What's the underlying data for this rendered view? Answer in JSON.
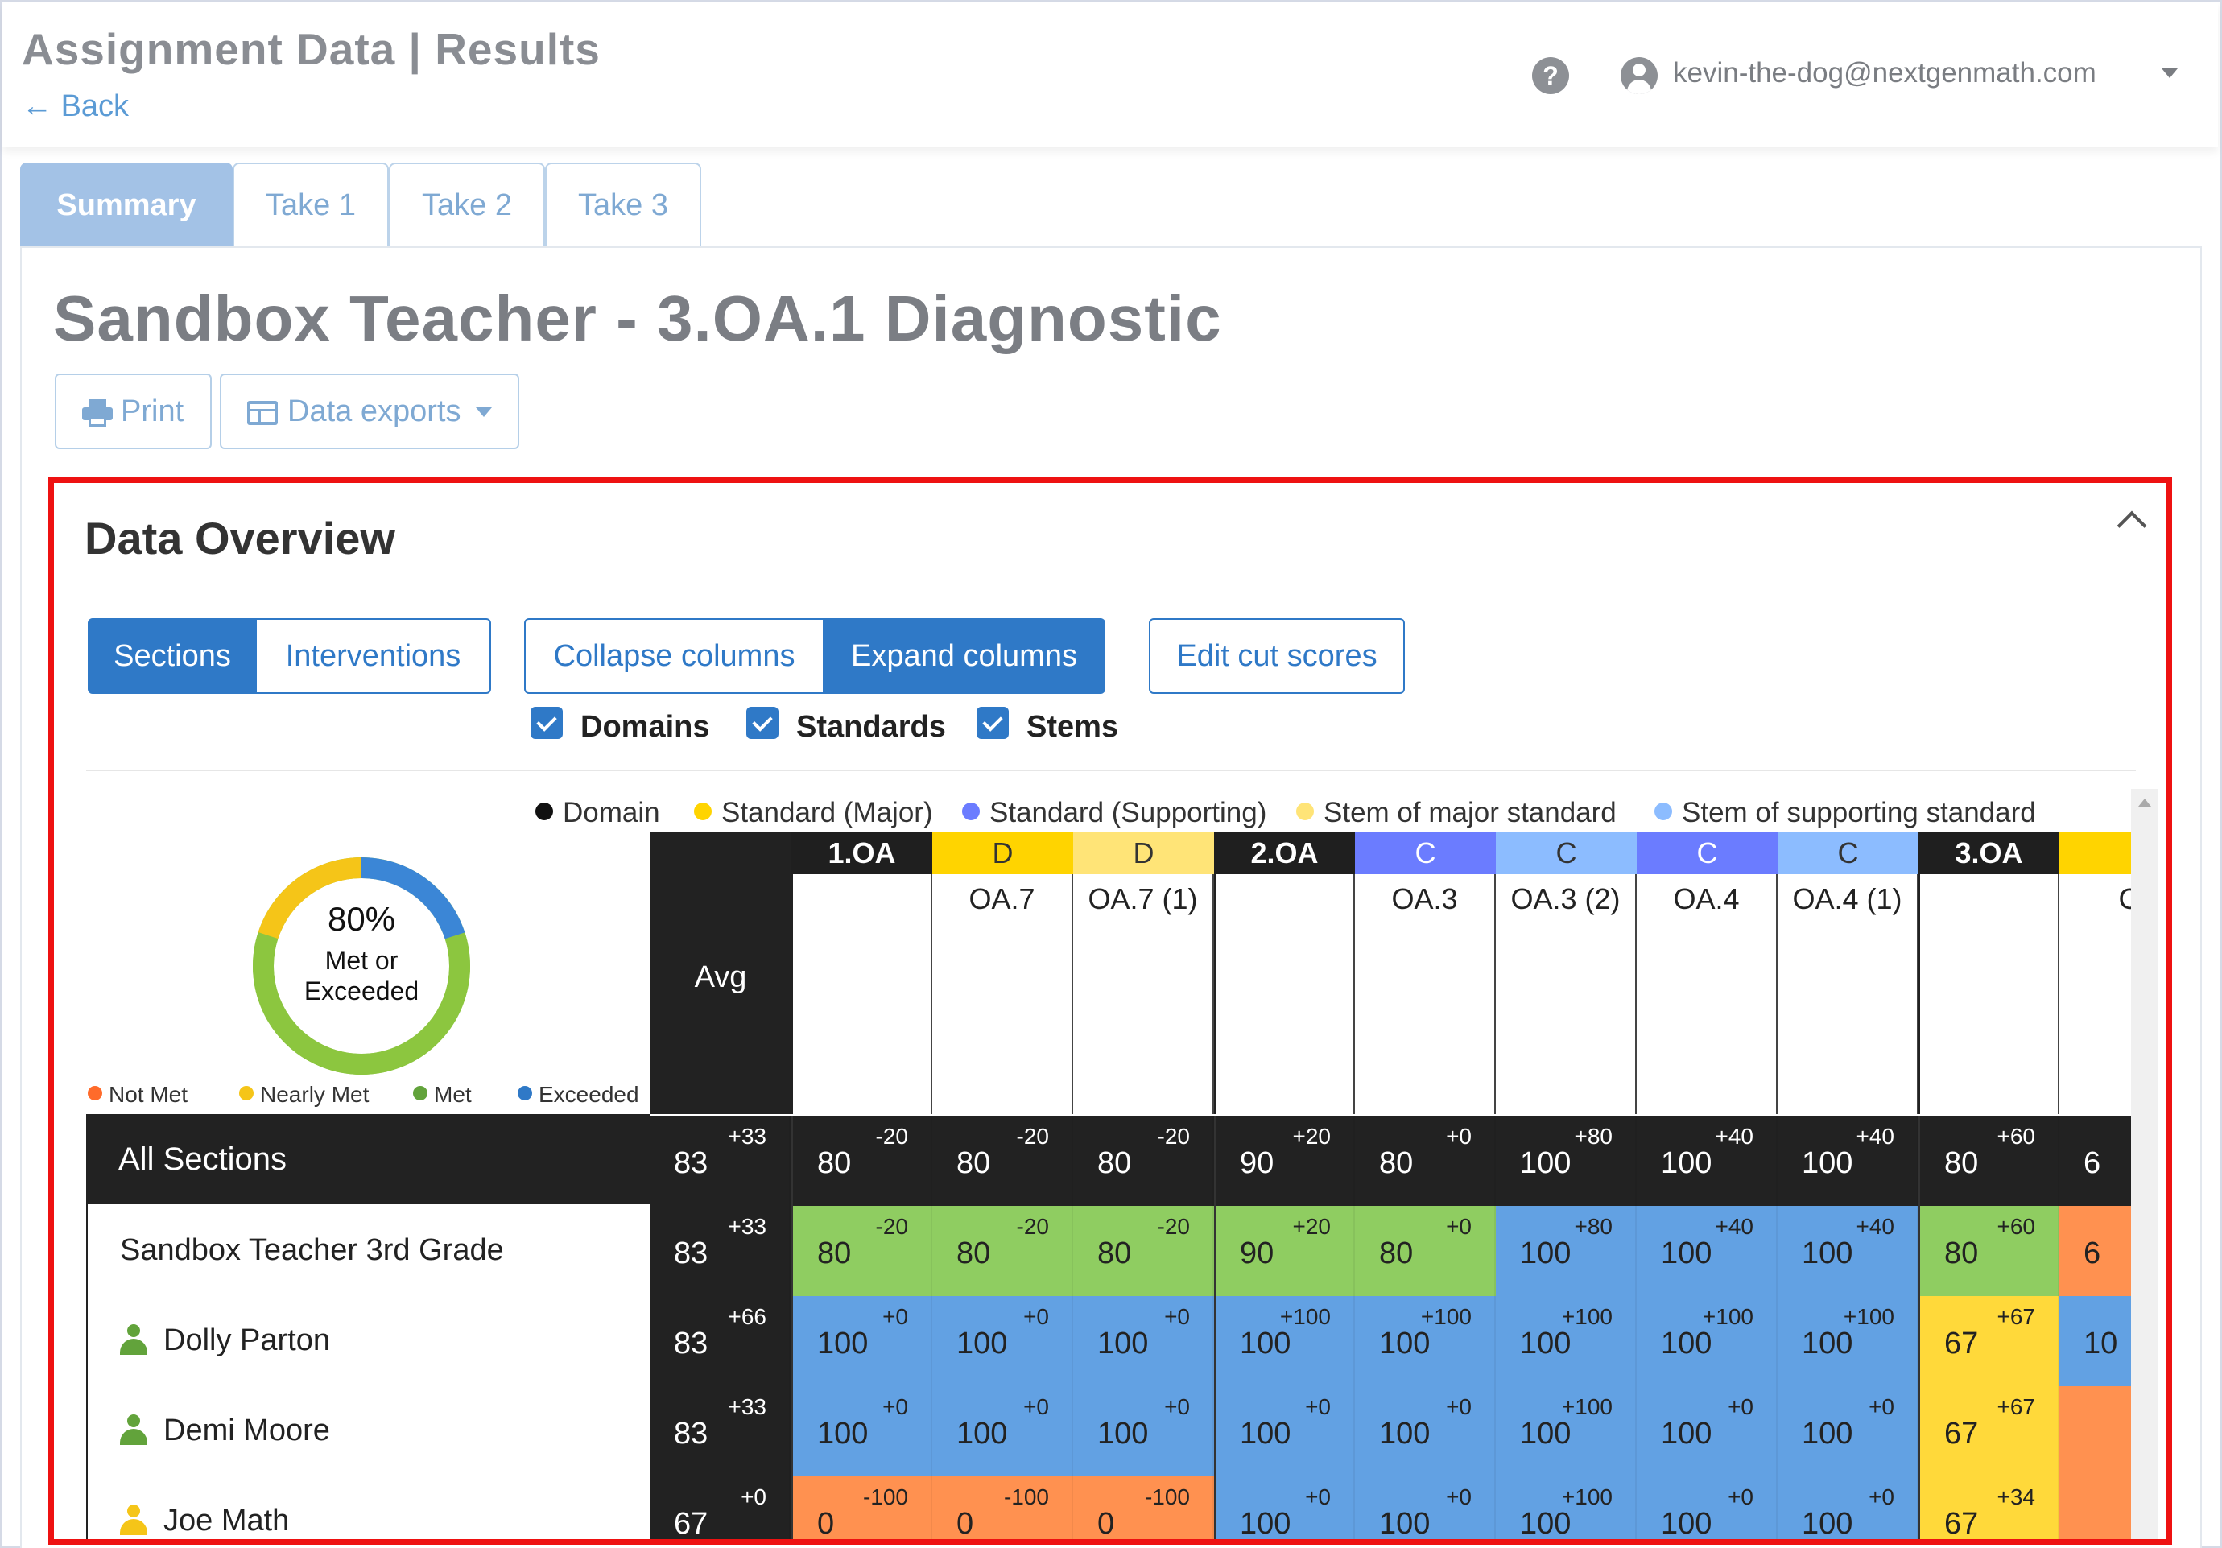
{
  "header": {
    "app_title": "Assignment Data | Results",
    "back_label": "Back",
    "help_glyph": "?",
    "user_email": "kevin-the-dog@nextgenmath.com"
  },
  "tabs": [
    {
      "label": "Summary",
      "active": true
    },
    {
      "label": "Take 1",
      "active": false
    },
    {
      "label": "Take 2",
      "active": false
    },
    {
      "label": "Take 3",
      "active": false
    }
  ],
  "page": {
    "title": "Sandbox Teacher - 3.OA.1 Diagnostic",
    "print_label": "Print",
    "exports_label": "Data exports"
  },
  "overview": {
    "title": "Data Overview",
    "view_toggle": [
      {
        "label": "Sections",
        "active": true
      },
      {
        "label": "Interventions",
        "active": false
      }
    ],
    "column_toggle": [
      {
        "label": "Collapse columns",
        "active": false
      },
      {
        "label": "Expand columns",
        "active": true
      }
    ],
    "edit_cut_scores": "Edit cut scores",
    "checkboxes": [
      {
        "label": "Domains",
        "checked": true
      },
      {
        "label": "Standards",
        "checked": true
      },
      {
        "label": "Stems",
        "checked": true
      }
    ],
    "legend_types": [
      {
        "label": "Domain",
        "color": "#111111"
      },
      {
        "label": "Standard (Major)",
        "color": "#ffd400"
      },
      {
        "label": "Standard (Supporting)",
        "color": "#6b7cff"
      },
      {
        "label": "Stem of major standard",
        "color": "#ffe477"
      },
      {
        "label": "Stem of supporting standard",
        "color": "#8cbcff"
      }
    ],
    "donut": {
      "percent": "80%",
      "caption_line1": "Met or",
      "caption_line2": "Exceeded",
      "segments": [
        {
          "name": "Exceeded",
          "fraction": 0.2,
          "color": "#3b86d6"
        },
        {
          "name": "Met",
          "fraction": 0.6,
          "color": "#8cc63f"
        },
        {
          "name": "Nearly Met",
          "fraction": 0.2,
          "color": "#f5c518"
        }
      ]
    },
    "legend_levels": [
      {
        "label": "Not Met",
        "color": "#ff6b2b"
      },
      {
        "label": "Nearly Met",
        "color": "#f5c518"
      },
      {
        "label": "Met",
        "color": "#62a33b"
      },
      {
        "label": "Exceeded",
        "color": "#2f79c7"
      }
    ],
    "avg_label": "Avg",
    "colors": {
      "blue": "#62a1e3",
      "green": "#8fcd61",
      "orange": "#ff9150",
      "yellow": "#ffd93a"
    },
    "columns": [
      {
        "badge": "1.OA",
        "kind": "domain",
        "name": ""
      },
      {
        "badge": "D",
        "kind": "major",
        "name": "OA.7"
      },
      {
        "badge": "D",
        "kind": "major-stem",
        "name": "OA.7 (1)"
      },
      {
        "badge": "2.OA",
        "kind": "domain",
        "name": ""
      },
      {
        "badge": "C",
        "kind": "supporting",
        "name": "OA.3"
      },
      {
        "badge": "C",
        "kind": "supporting-stem",
        "name": "OA.3 (2)"
      },
      {
        "badge": "C",
        "kind": "supporting",
        "name": "OA.4"
      },
      {
        "badge": "C",
        "kind": "supporting-stem",
        "name": "OA.4 (1)"
      },
      {
        "badge": "3.OA",
        "kind": "domain",
        "name": ""
      },
      {
        "badge": "",
        "kind": "major",
        "name": "C"
      }
    ],
    "rows": [
      {
        "name": "All Sections",
        "type": "all",
        "avg": "83",
        "avg_delta": "+33",
        "cells": [
          [
            "80",
            "-20",
            ""
          ],
          [
            "80",
            "-20",
            ""
          ],
          [
            "80",
            "-20",
            ""
          ],
          [
            "90",
            "+20",
            ""
          ],
          [
            "80",
            "+0",
            ""
          ],
          [
            "100",
            "+80",
            ""
          ],
          [
            "100",
            "+40",
            ""
          ],
          [
            "100",
            "+40",
            ""
          ],
          [
            "80",
            "+60",
            ""
          ],
          [
            "6",
            "",
            ""
          ]
        ]
      },
      {
        "name": "Sandbox Teacher 3rd Grade",
        "type": "section",
        "avg": "83",
        "avg_delta": "+33",
        "cells": [
          [
            "80",
            "-20",
            "green"
          ],
          [
            "80",
            "-20",
            "green"
          ],
          [
            "80",
            "-20",
            "green"
          ],
          [
            "90",
            "+20",
            "green"
          ],
          [
            "80",
            "+0",
            "green"
          ],
          [
            "100",
            "+80",
            "blue"
          ],
          [
            "100",
            "+40",
            "blue"
          ],
          [
            "100",
            "+40",
            "blue"
          ],
          [
            "80",
            "+60",
            "green"
          ],
          [
            "6",
            "",
            "orange"
          ]
        ]
      },
      {
        "name": "Dolly Parton",
        "type": "student",
        "status": "met",
        "avg": "83",
        "avg_delta": "+66",
        "cells": [
          [
            "100",
            "+0",
            "blue"
          ],
          [
            "100",
            "+0",
            "blue"
          ],
          [
            "100",
            "+0",
            "blue"
          ],
          [
            "100",
            "+100",
            "blue"
          ],
          [
            "100",
            "+100",
            "blue"
          ],
          [
            "100",
            "+100",
            "blue"
          ],
          [
            "100",
            "+100",
            "blue"
          ],
          [
            "100",
            "+100",
            "blue"
          ],
          [
            "67",
            "+67",
            "yellow"
          ],
          [
            "10",
            "",
            "blue"
          ]
        ]
      },
      {
        "name": "Demi Moore",
        "type": "student",
        "status": "met",
        "avg": "83",
        "avg_delta": "+33",
        "cells": [
          [
            "100",
            "+0",
            "blue"
          ],
          [
            "100",
            "+0",
            "blue"
          ],
          [
            "100",
            "+0",
            "blue"
          ],
          [
            "100",
            "+0",
            "blue"
          ],
          [
            "100",
            "+0",
            "blue"
          ],
          [
            "100",
            "+100",
            "blue"
          ],
          [
            "100",
            "+0",
            "blue"
          ],
          [
            "100",
            "+0",
            "blue"
          ],
          [
            "67",
            "+67",
            "yellow"
          ],
          [
            "",
            "",
            "orange"
          ]
        ]
      },
      {
        "name": "Joe Math",
        "type": "student",
        "status": "nearly",
        "avg": "67",
        "avg_delta": "+0",
        "cells": [
          [
            "0",
            "-100",
            "orange"
          ],
          [
            "0",
            "-100",
            "orange"
          ],
          [
            "0",
            "-100",
            "orange"
          ],
          [
            "100",
            "+0",
            "blue"
          ],
          [
            "100",
            "+0",
            "blue"
          ],
          [
            "100",
            "+100",
            "blue"
          ],
          [
            "100",
            "+0",
            "blue"
          ],
          [
            "100",
            "+0",
            "blue"
          ],
          [
            "67",
            "+34",
            "yellow"
          ],
          [
            "",
            "",
            "orange"
          ]
        ]
      }
    ]
  }
}
